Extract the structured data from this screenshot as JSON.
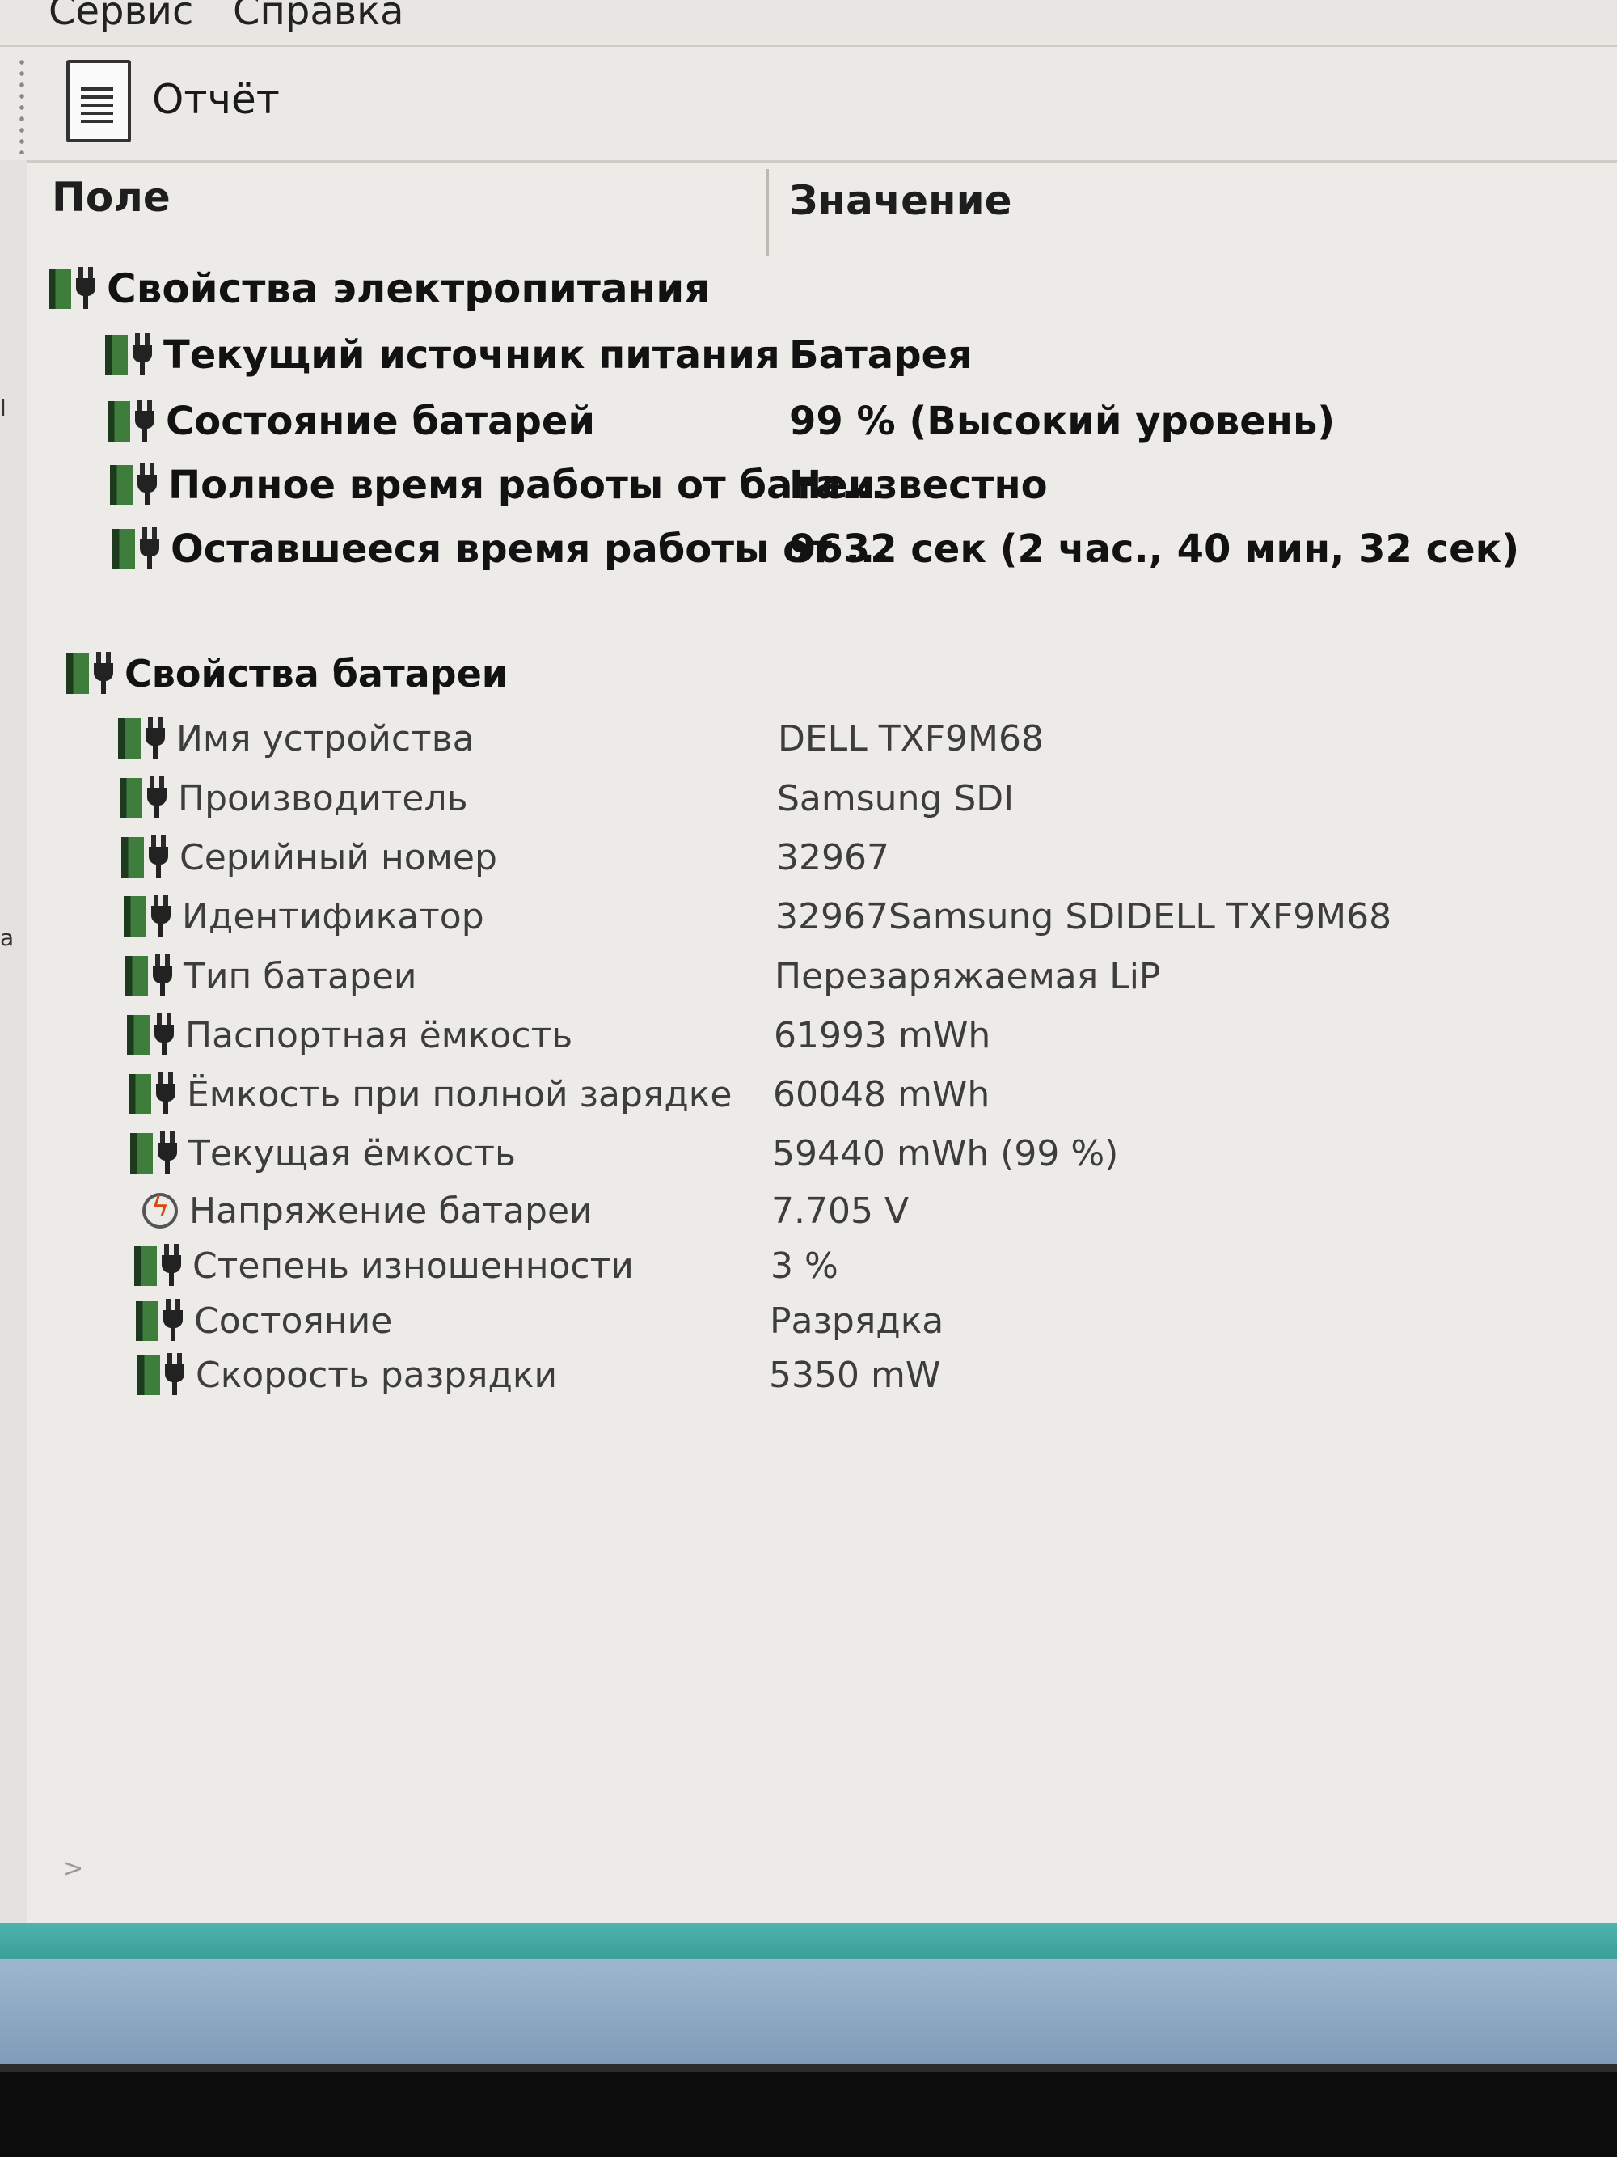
{
  "menu": [
    "Сервис",
    "Справка"
  ],
  "toolbar": {
    "report_label": "Отчёт"
  },
  "columns": {
    "field": "Поле",
    "value": "Значение"
  },
  "groups": [
    {
      "title": "Свойства электропитания",
      "items": [
        {
          "field": "Текущий источник питания",
          "value": "Батарея"
        },
        {
          "field": "Состояние батарей",
          "value": "99 % (Высокий уровень)"
        },
        {
          "field": "Полное время работы от бата...",
          "value": "Неизвестно"
        },
        {
          "field": "Оставшееся время работы от ...",
          "value": "9632 сек (2 час., 40 мин, 32 сек)"
        }
      ]
    },
    {
      "title": "Свойства батареи",
      "items": [
        {
          "field": "Имя устройства",
          "value": "DELL TXF9M68"
        },
        {
          "field": "Производитель",
          "value": "Samsung SDI"
        },
        {
          "field": "Серийный номер",
          "value": "32967"
        },
        {
          "field": "Идентификатор",
          "value": "32967Samsung SDIDELL TXF9M68"
        },
        {
          "field": "Тип батареи",
          "value": "Перезаряжаемая LiP"
        },
        {
          "field": "Паспортная ёмкость",
          "value": "61993 mWh"
        },
        {
          "field": "Ёмкость при полной зарядке",
          "value": "60048 mWh"
        },
        {
          "field": "Текущая ёмкость",
          "value": "59440 mWh  (99 %)"
        },
        {
          "field": "Напряжение батареи",
          "value": "7.705 V"
        },
        {
          "field": "Степень изношенности",
          "value": "3 %"
        },
        {
          "field": "Состояние",
          "value": "Разрядка"
        },
        {
          "field": "Скорость разрядки",
          "value": "5350 mW"
        }
      ]
    }
  ],
  "icons": {
    "group": "battery-plug-icon",
    "item": "battery-plug-icon",
    "voltage": "voltage-icon",
    "toolbar": "report-document-icon"
  },
  "colors": {
    "battery_green": "#3f7d3d",
    "taskbar_teal": "#4fb3ad",
    "taskbar_blue": "#9db7cf"
  }
}
